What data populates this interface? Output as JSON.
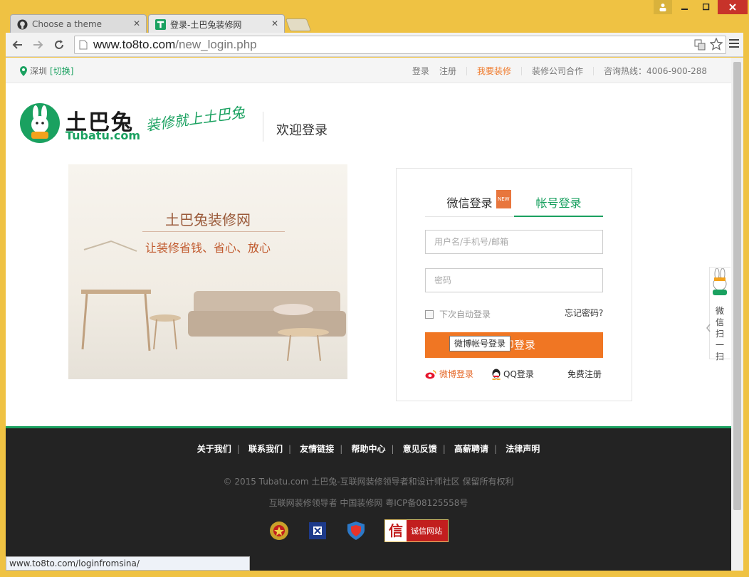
{
  "browser": {
    "tabs": [
      {
        "label": "Choose a theme",
        "icon": "github-icon",
        "active": false
      },
      {
        "label": "登录-土巴兔装修网",
        "icon": "tubatu-favicon",
        "active": true
      }
    ],
    "url_host": "www.to8to.com",
    "url_path": "/new_login.php",
    "status_url": "www.to8to.com/loginfromsina/"
  },
  "topnav": {
    "city": "深圳",
    "switch_label": "[切换]",
    "login": "登录",
    "register": "注册",
    "decorate": "我要装修",
    "cooperate": "装修公司合作",
    "hotline": "咨询热线：4006-900-288"
  },
  "header": {
    "logo_cn": "土巴兔",
    "logo_en": "Tubatu.com",
    "slogan": "装修就上土巴兔",
    "welcome": "欢迎登录"
  },
  "hero": {
    "title": "土巴兔装修网",
    "subtitle": "让装修省钱、省心、放心"
  },
  "login": {
    "tab_wechat": "微信登录",
    "tab_account": "帐号登录",
    "new_badge": "NEW",
    "username_placeholder": "用户名/手机号/邮箱",
    "password_placeholder": "密码",
    "remember": "下次自动登录",
    "forgot": "忘记密码?",
    "submit": "立即登录",
    "weibo": "微博登录",
    "qq": "QQ登录",
    "register": "免费注册",
    "tooltip": "微博帐号登录"
  },
  "float_widget": {
    "text": "微信扫一扫"
  },
  "footer": {
    "links": [
      "关于我们",
      "联系我们",
      "友情链接",
      "帮助中心",
      "意见反馈",
      "高薪聘请",
      "法律声明"
    ],
    "copyright": "© 2015 Tubatu.com 土巴兔-互联网装修领导者和设计师社区 保留所有权利",
    "icp": "互联网装修领导者 中国装修网 粤ICP备08125558号",
    "credit_icon": "信",
    "credit_label": "诚信网站"
  },
  "colors": {
    "brand_green": "#1aa160",
    "accent_orange": "#f07623",
    "footer_bg": "#232323"
  }
}
